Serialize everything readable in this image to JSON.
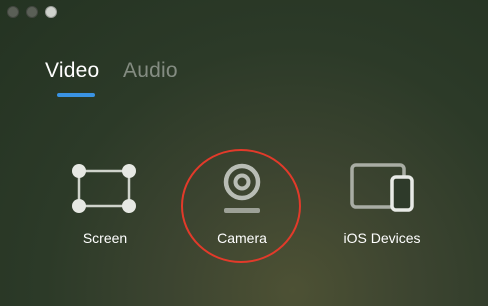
{
  "window": {
    "controls": [
      "close",
      "minimize",
      "zoom"
    ]
  },
  "tabs": [
    {
      "label": "Video",
      "active": true
    },
    {
      "label": "Audio",
      "active": false
    }
  ],
  "sources": [
    {
      "label": "Screen",
      "icon": "screen-capture-icon"
    },
    {
      "label": "Camera",
      "icon": "camera-icon",
      "highlighted": true
    },
    {
      "label": "iOS Devices",
      "icon": "ios-devices-icon"
    }
  ],
  "colors": {
    "accent": "#3a93e3",
    "highlight": "#e23a2a",
    "icon": "#cfd3cb"
  }
}
